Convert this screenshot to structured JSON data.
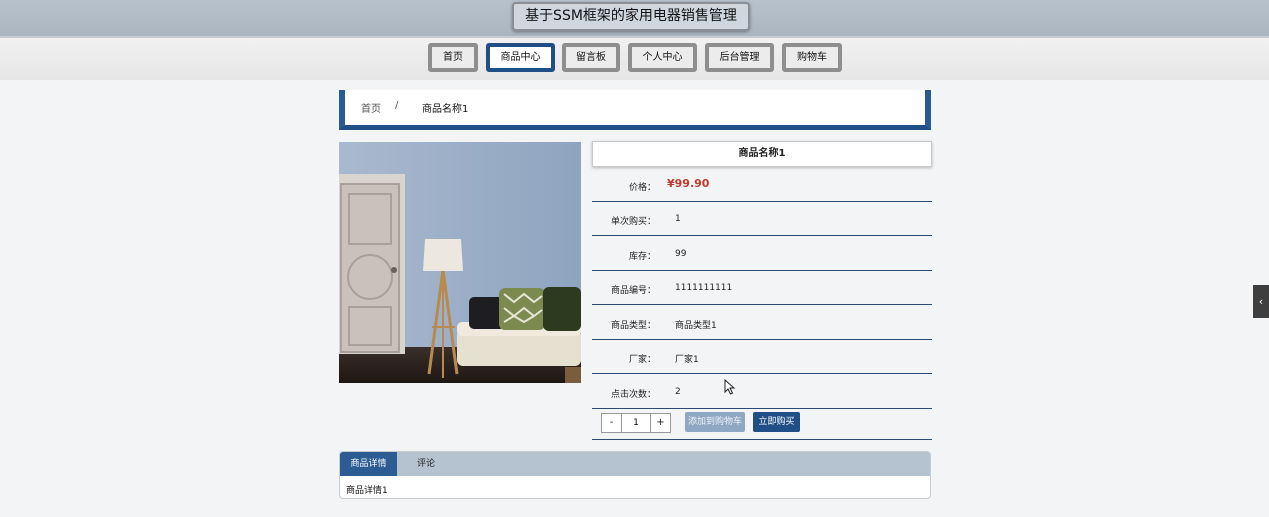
{
  "header": {
    "title": "基于SSM框架的家用电器销售管理"
  },
  "nav": {
    "items": [
      {
        "label": "首页"
      },
      {
        "label": "商品中心"
      },
      {
        "label": "留言板"
      },
      {
        "label": "个人中心"
      },
      {
        "label": "后台管理"
      },
      {
        "label": "购物车"
      }
    ],
    "active": "商品中心"
  },
  "breadcrumb": {
    "home": "首页",
    "separator": "/",
    "current": "商品名称1"
  },
  "product": {
    "name": "商品名称1",
    "fields": [
      {
        "label": "价格：",
        "value": "¥99.90"
      },
      {
        "label": "单次购买：",
        "value": "1"
      },
      {
        "label": "库存：",
        "value": "99"
      },
      {
        "label": "商品编号：",
        "value": "1111111111"
      },
      {
        "label": "商品类型：",
        "value": "商品类型1"
      },
      {
        "label": "厂家：",
        "value": "厂家1"
      },
      {
        "label": "点击次数：",
        "value": "2"
      }
    ],
    "quantity": {
      "minus": "-",
      "value": "1",
      "plus": "+"
    },
    "add_to_cart": "添加到购物车",
    "buy_now": "立即购买"
  },
  "tabs": {
    "items": [
      {
        "label": "商品详情"
      },
      {
        "label": "评论"
      }
    ],
    "active": "商品详情",
    "content": "商品详情1"
  },
  "side_toggle": {
    "icon": "chevron-left-icon",
    "glyph": "‹"
  },
  "colors": {
    "accent": "#1f4f86",
    "price": "#c0392b",
    "banner": "#b0bbc6"
  }
}
